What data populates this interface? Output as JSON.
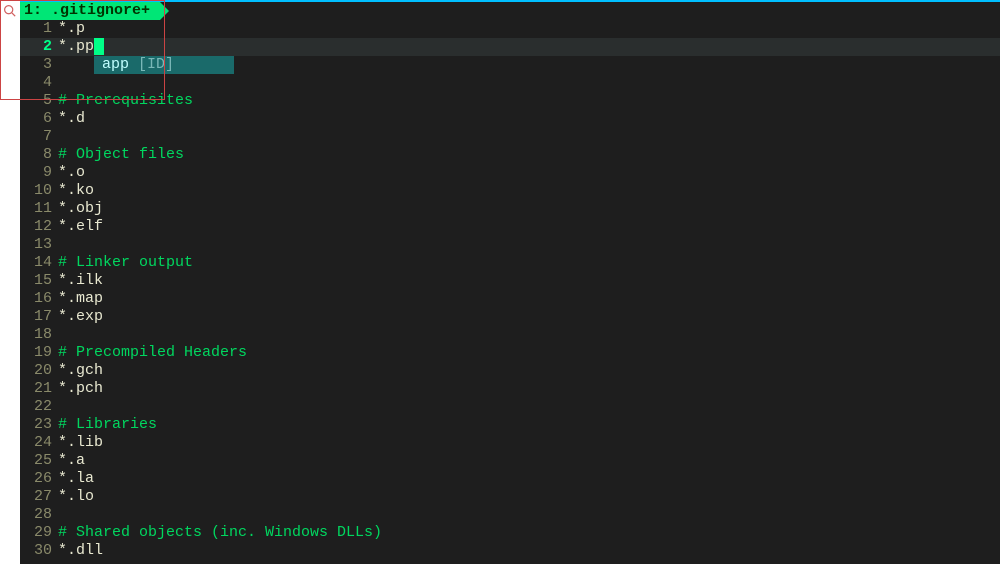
{
  "tab": {
    "label": "1: .gitignore+"
  },
  "completion": {
    "text": "app",
    "meta": "[ID]"
  },
  "gutter_numbers": [
    "1",
    "2",
    "3",
    "4",
    "5",
    "6",
    "7",
    "8",
    "9",
    "10",
    "11",
    "12",
    "13",
    "14",
    "15",
    "16",
    "17",
    "18",
    "19",
    "20",
    "21",
    "22",
    "23",
    "24",
    "25",
    "26",
    "27",
    "28",
    "29",
    "30"
  ],
  "lines": [
    {
      "num": "1",
      "text": "*.p",
      "type": "plain"
    },
    {
      "num": "2",
      "text": "*.pp",
      "type": "current"
    },
    {
      "num": "3",
      "text": "",
      "type": "plain"
    },
    {
      "num": "4",
      "text": "",
      "type": "plain"
    },
    {
      "num": "5",
      "text": "# Prerequisites",
      "type": "comment"
    },
    {
      "num": "6",
      "text": "*.d",
      "type": "plain"
    },
    {
      "num": "7",
      "text": "",
      "type": "plain"
    },
    {
      "num": "8",
      "text": "# Object files",
      "type": "comment"
    },
    {
      "num": "9",
      "text": "*.o",
      "type": "plain"
    },
    {
      "num": "10",
      "text": "*.ko",
      "type": "plain"
    },
    {
      "num": "11",
      "text": "*.obj",
      "type": "plain"
    },
    {
      "num": "12",
      "text": "*.elf",
      "type": "plain"
    },
    {
      "num": "13",
      "text": "",
      "type": "plain"
    },
    {
      "num": "14",
      "text": "# Linker output",
      "type": "comment"
    },
    {
      "num": "15",
      "text": "*.ilk",
      "type": "plain"
    },
    {
      "num": "16",
      "text": "*.map",
      "type": "plain"
    },
    {
      "num": "17",
      "text": "*.exp",
      "type": "plain"
    },
    {
      "num": "18",
      "text": "",
      "type": "plain"
    },
    {
      "num": "19",
      "text": "# Precompiled Headers",
      "type": "comment"
    },
    {
      "num": "20",
      "text": "*.gch",
      "type": "plain"
    },
    {
      "num": "21",
      "text": "*.pch",
      "type": "plain"
    },
    {
      "num": "22",
      "text": "",
      "type": "plain"
    },
    {
      "num": "23",
      "text": "# Libraries",
      "type": "comment"
    },
    {
      "num": "24",
      "text": "*.lib",
      "type": "plain"
    },
    {
      "num": "25",
      "text": "*.a",
      "type": "plain"
    },
    {
      "num": "26",
      "text": "*.la",
      "type": "plain"
    },
    {
      "num": "27",
      "text": "*.lo",
      "type": "plain"
    },
    {
      "num": "28",
      "text": "",
      "type": "plain"
    },
    {
      "num": "29",
      "text": "# Shared objects (inc. Windows DLLs)",
      "type": "comment"
    },
    {
      "num": "30",
      "text": "*.dll",
      "type": "plain"
    }
  ]
}
